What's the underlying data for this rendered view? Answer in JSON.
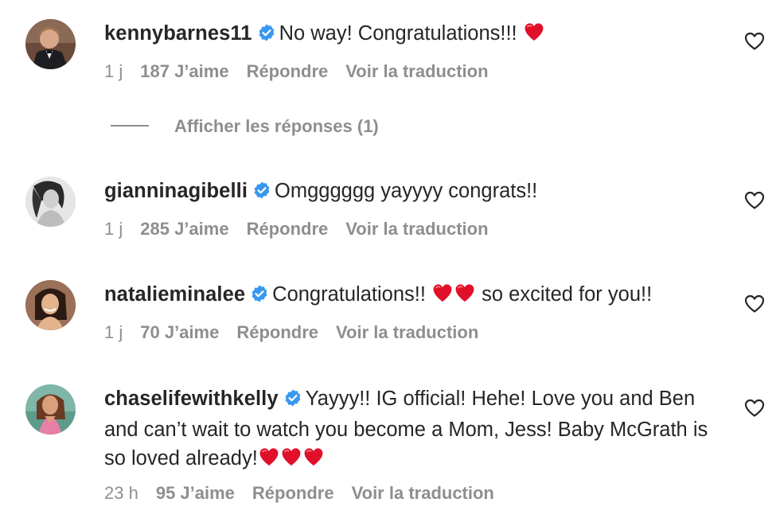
{
  "colors": {
    "text": "#262626",
    "secondary": "#8e8e8e",
    "verified": "#3897f0",
    "heart_emoji": "#e0102a"
  },
  "comments": [
    {
      "username": "kennybarnes11",
      "verified": true,
      "text_before": "No way! Congratulations!!!",
      "emoji_hearts": 1,
      "text_after": "",
      "time": "1 j",
      "likes": "187 J’aime",
      "reply_label": "Répondre",
      "translate_label": "Voir la traduction",
      "avatar_icon": "avatar-man-suit"
    },
    {
      "username": "gianninagibelli",
      "verified": true,
      "text_before": "Omgggggg yayyyy congrats!!",
      "emoji_hearts": 0,
      "text_after": "",
      "time": "1 j",
      "likes": "285 J’aime",
      "reply_label": "Répondre",
      "translate_label": "Voir la traduction",
      "avatar_icon": "avatar-woman-bw"
    },
    {
      "username": "natalieminalee",
      "verified": true,
      "text_before": "Congratulations!!",
      "emoji_hearts": 2,
      "text_after": "so excited for you!!",
      "time": "1 j",
      "likes": "70 J’aime",
      "reply_label": "Répondre",
      "translate_label": "Voir la traduction",
      "avatar_icon": "avatar-woman-smile"
    },
    {
      "username": "chaselifewithkelly",
      "verified": true,
      "text_before": "Yayyy!! IG official! Hehe! Love you and Ben and can’t wait to watch you become a Mom, Jess! Baby McGrath is so loved already!",
      "emoji_hearts": 3,
      "text_after": "",
      "time": "23 h",
      "likes": "95 J’aime",
      "reply_label": "Répondre",
      "translate_label": "Voir la traduction",
      "avatar_icon": "avatar-woman-pink"
    }
  ],
  "replies_toggle": {
    "label": "Afficher les réponses (1)"
  }
}
